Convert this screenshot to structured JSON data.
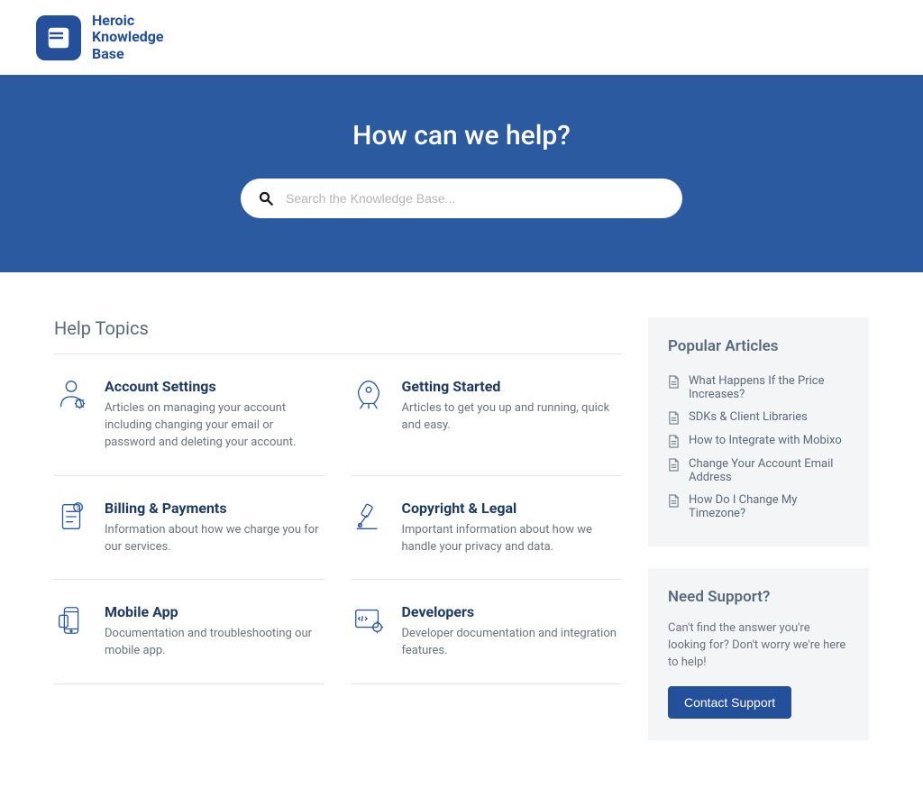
{
  "brand": {
    "line1": "Heroic",
    "line2": "Knowledge",
    "line3": "Base"
  },
  "hero": {
    "title": "How can we help?",
    "placeholder": "Search the Knowledge Base..."
  },
  "helpTopicsHeading": "Help Topics",
  "topics": [
    {
      "title": "Account Settings",
      "desc": "Articles on managing your account including changing your email or password and deleting your account."
    },
    {
      "title": "Getting Started",
      "desc": "Articles to get you up and running, quick and easy."
    },
    {
      "title": "Billing & Payments",
      "desc": "Information about how we charge you for our services."
    },
    {
      "title": "Copyright & Legal",
      "desc": "Important information about how we handle your privacy and data."
    },
    {
      "title": "Mobile App",
      "desc": "Documentation and troubleshooting our mobile app."
    },
    {
      "title": "Developers",
      "desc": "Developer documentation and integration features."
    }
  ],
  "popular": {
    "heading": "Popular Articles",
    "items": [
      "What Happens If the Price Increases?",
      "SDKs & Client Libraries",
      "How to Integrate with Mobixo",
      "Change Your Account Email Address",
      "How Do I Change My Timezone?"
    ]
  },
  "support": {
    "heading": "Need Support?",
    "text": "Can't find the answer you're looking for? Don't worry we're here to help!",
    "button": "Contact Support"
  }
}
